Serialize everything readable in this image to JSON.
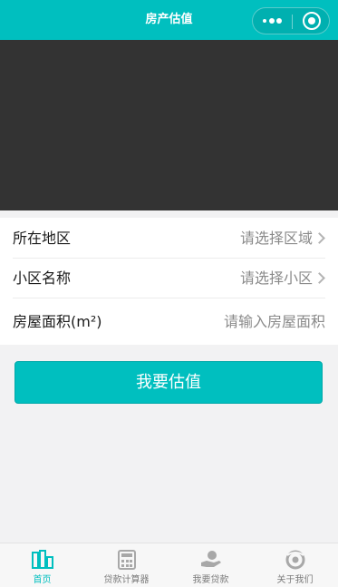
{
  "navbar": {
    "title": "房产估值",
    "capsule": {
      "more_icon": "more-dots-icon",
      "close_icon": "target-circle-icon"
    }
  },
  "banner": {
    "color": "#333333"
  },
  "form": {
    "rows": [
      {
        "label": "所在地区",
        "value": "请选择区域"
      },
      {
        "label": "小区名称",
        "value": "请选择小区"
      },
      {
        "label": "房屋面积(m²)",
        "placeholder": "请输入房屋面积"
      }
    ]
  },
  "submit": {
    "label": "我要估值"
  },
  "tabbar": {
    "items": [
      {
        "label": "首页",
        "icon": "buildings-icon",
        "active": true
      },
      {
        "label": "贷款计算器",
        "icon": "calculator-icon",
        "active": false
      },
      {
        "label": "我要贷款",
        "icon": "hand-money-icon",
        "active": false
      },
      {
        "label": "关于我们",
        "icon": "about-swirl-icon",
        "active": false
      }
    ]
  },
  "colors": {
    "accent": "#00bfbf",
    "background": "#f2f2f3",
    "placeholder": "#8a8a8a",
    "tab_inactive": "#7b7b7b"
  }
}
